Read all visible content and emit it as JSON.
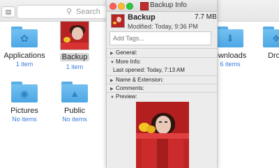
{
  "finder": {
    "toolbar": {
      "view_icon": "columns-view-icon",
      "search_placeholder": "Search",
      "search_icon": "magnifier-icon"
    },
    "items": [
      {
        "name": "Applications",
        "sub": "1 item",
        "icon": "applications-folder-icon"
      },
      {
        "name": "Backup",
        "sub": "1 item",
        "icon": "image-thumbnail",
        "selected": true
      },
      {
        "name": "Downloads",
        "sub": "6 items",
        "icon": "downloads-folder-icon",
        "visible_text": "ownloads"
      },
      {
        "name": "Dropbox",
        "sub": "",
        "icon": "dropbox-folder-icon",
        "visible_text": "Drop"
      },
      {
        "name": "Pictures",
        "sub": "No items",
        "icon": "pictures-folder-icon"
      },
      {
        "name": "Public",
        "sub": "No items",
        "icon": "public-folder-icon"
      }
    ]
  },
  "info_panel": {
    "window_title": "Backup Info",
    "file_name": "Backup",
    "file_size": "7.7 MB",
    "modified": "Modified: Today, 9:36 PM",
    "tags_placeholder": "Add Tags...",
    "sections": {
      "general": "General:",
      "more_info": "More Info:",
      "last_opened": "Last opened: Today, 7:13 AM",
      "name_extension": "Name & Extension:",
      "comments": "Comments:",
      "preview": "Preview:"
    },
    "colors": {
      "close": "#fc5f57",
      "minimize": "#fdbc2e",
      "zoom": "#28c840"
    }
  }
}
